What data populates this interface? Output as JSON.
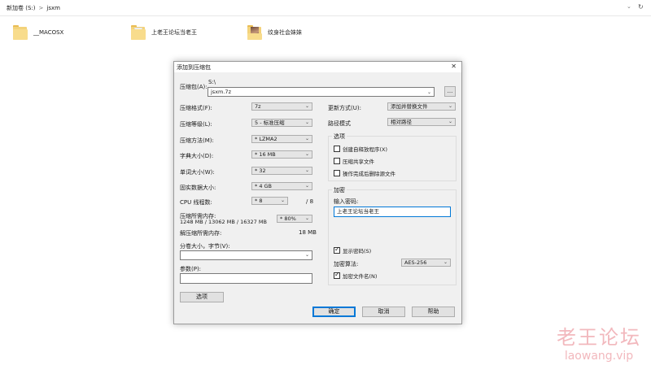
{
  "explorer": {
    "breadcrumb": [
      "新加卷 (S:)",
      "jsxm"
    ],
    "sep": ">",
    "items": [
      {
        "name": "__MACOSX",
        "icon": "folder-icon"
      },
      {
        "name": "上老王论坛当老王",
        "icon": "folder-icon"
      },
      {
        "name": "纹身社会妹妹",
        "icon": "folder-photo-icon"
      }
    ]
  },
  "dialog": {
    "title": "添加到压缩包",
    "close": "✕",
    "archive_label": "压缩包(A):",
    "archive_dir": "S:\\",
    "archive_name": "jsxm.7z",
    "browse_label": "...",
    "left": [
      {
        "label": "压缩格式(F):",
        "value": "7z"
      },
      {
        "label": "压缩等级(L):",
        "value": "5 - 标准压缩"
      },
      {
        "label": "压缩方法(M):",
        "value": "* LZMA2"
      },
      {
        "label": "字典大小(D):",
        "value": "* 16 MB"
      },
      {
        "label": "单词大小(W):",
        "value": "* 32"
      },
      {
        "label": "固实数据大小:",
        "value": "* 4 GB"
      },
      {
        "label": "CPU 线程数:",
        "value": "* 8",
        "extra": "/ 8"
      }
    ],
    "mem_label": "压缩所需内存:",
    "mem_values": "1248 MB / 13062 MB / 16327 MB",
    "mem_percent": "* 80%",
    "decomp_label": "解压缩所需内存:",
    "decomp_value": "18 MB",
    "split_label": "分卷大小，字节(V):",
    "params_label": "参数(P):",
    "options_button": "选项",
    "update_label": "更新方式(U):",
    "update_value": "添加并替换文件",
    "path_label": "路径模式",
    "path_value": "相对路径",
    "options_group": "选项",
    "options_checks": [
      {
        "label": "创建自释放程序(X)",
        "checked": false
      },
      {
        "label": "压缩共享文件",
        "checked": false
      },
      {
        "label": "操作完成后删除源文件",
        "checked": false
      }
    ],
    "encrypt_group": "加密",
    "password_label": "输入密码:",
    "password_value": "上老王论坛当老王",
    "show_password": {
      "label": "显示密码(S)",
      "checked": true
    },
    "enc_method_label": "加密算法:",
    "enc_method_value": "AES-256",
    "encrypt_names": {
      "label": "加密文件名(N)",
      "checked": true
    },
    "ok": "确定",
    "cancel": "取消",
    "help": "帮助"
  },
  "watermark": {
    "cn": "老王论坛",
    "en": "laowang.vip"
  }
}
